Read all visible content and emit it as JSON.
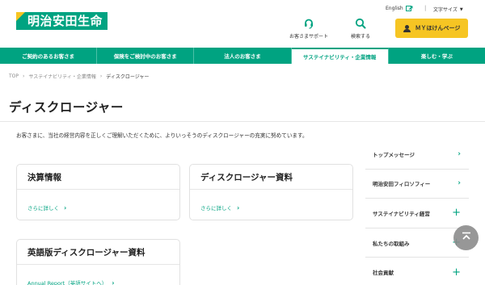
{
  "header": {
    "logo_text": "明治安田生命",
    "english_label": "English",
    "font_size_label": "文字サイズ",
    "support_label": "お客さまサポート",
    "search_label": "検索する",
    "mypage_label": "ＭＹほけんページ"
  },
  "nav": {
    "items": [
      {
        "label": "ご契約のあるお客さま"
      },
      {
        "label": "保険をご検討中のお客さま"
      },
      {
        "label": "法人のお客さま"
      },
      {
        "label": "サステイナビリティ・企業情報"
      },
      {
        "label": "楽しむ・学ぶ"
      }
    ],
    "active_index": 3
  },
  "breadcrumb": [
    "TOP",
    "サステイナビリティ・企業情報",
    "ディスクロージャー"
  ],
  "page": {
    "title": "ディスクロージャー",
    "intro": "お客さまに、当社の経営内容を正しくご理解いただくために、よりいっそうのディスクロージャーの充実に努めています。"
  },
  "cards": [
    {
      "title": "決算情報",
      "link": "さらに詳しく"
    },
    {
      "title": "ディスクロージャー資料",
      "link": "さらに詳しく"
    },
    {
      "title": "英語版ディスクロージャー資料",
      "link": "Annual Report（英語サイトへ）"
    }
  ],
  "side_menu": [
    {
      "label": "トップメッセージ",
      "mark": "›"
    },
    {
      "label": "明治安田フィロソフィー",
      "mark": "›"
    },
    {
      "label": "サステイナビリティ経営",
      "mark": "+"
    },
    {
      "label": "私たちの取組み",
      "mark": "+"
    },
    {
      "label": "社会貢献",
      "mark": "+"
    }
  ],
  "colors": {
    "brand_green": "#00a381",
    "brand_yellow": "#f6c523"
  },
  "icons": {
    "support": "headset-icon",
    "search": "magnifier-icon",
    "mypage": "person-icon",
    "external": "external-link-icon",
    "totop": "arrow-to-top-icon"
  }
}
